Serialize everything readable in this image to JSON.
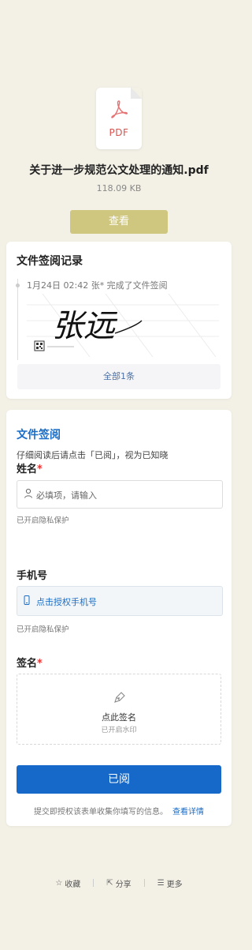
{
  "file": {
    "icon_label": "PDF",
    "name": "关于进一步规范公文处理的通知.pdf",
    "size": "118.09 KB",
    "view_label": "查看"
  },
  "records": {
    "title": "文件签阅记录",
    "entry": "1月24日 02:42  张* 完成了文件签阅",
    "signature_text": "张远",
    "more_label": "全部1条"
  },
  "form": {
    "title": "文件签阅",
    "subtitle": "仔细阅读后请点击「已阅」，视为已知晓",
    "name_label": "姓名",
    "required_mark": "*",
    "name_placeholder": "必填项，请输入",
    "name_privacy": "已开启隐私保护",
    "phone_label": "手机号",
    "phone_action": "点击授权手机号",
    "phone_privacy": "已开启隐私保护",
    "sign_label": "签名",
    "sign_action": "点此签名",
    "sign_watermark": "已开启水印",
    "submit_label": "已阅",
    "notice": "提交即授权该表单收集你填写的信息。",
    "notice_link": "查看详情"
  },
  "footer": {
    "favorite": "收藏",
    "share": "分享",
    "more": "更多"
  },
  "colors": {
    "background": "#f3f1e6",
    "view_button": "#cfc680",
    "accent_blue": "#1668c9",
    "required_red": "#e33333"
  }
}
